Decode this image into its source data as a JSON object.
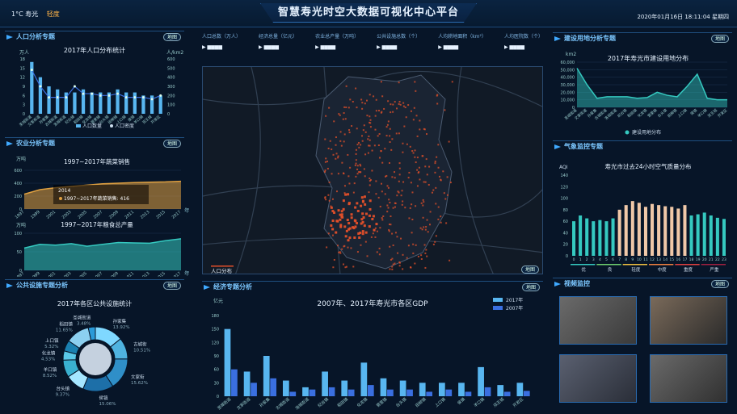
{
  "header": {
    "title": "智慧寿光时空大数据可视化中心平台",
    "weather_temp": "1°C 寿光",
    "weather_level": "轻度",
    "datetime": "2020年01月16日 18:11:04 星期四"
  },
  "stats": [
    {
      "label": "人口总数（万人）",
      "value": "—"
    },
    {
      "label": "经济总量（亿元）",
      "value": "—"
    },
    {
      "label": "农业总产量（万吨）",
      "value": "—"
    },
    {
      "label": "公共设施总数（个）",
      "value": "—"
    },
    {
      "label": "人均耕地面积（km²）",
      "value": "—"
    },
    {
      "label": "人均医院数（个）",
      "value": "—"
    }
  ],
  "map_btn": "地图",
  "panels": {
    "population": {
      "title": "人口分析专题",
      "chart_title": "2017年人口分布统计",
      "left_unit": "万人",
      "right_unit": "人/km2",
      "legend_bar": "人口数量",
      "legend_line": "人口密度"
    },
    "agriculture": {
      "title": "农业分析专题",
      "chart1_title": "1997~2017年蔬菜销售",
      "chart1_unit": "万吨",
      "tooltip_year": "2014",
      "tooltip_text": "1997~2017年蔬菜销售: 416",
      "chart2_title": "1997~2017年粮食总产量",
      "chart2_unit": "万吨",
      "year_suffix": "年"
    },
    "facilities": {
      "title": "公共设施专题分析",
      "chart_title": "2017年各区公共设施统计"
    },
    "economy": {
      "title": "经济专题分析",
      "chart_title": "2007年、2017年寿光市各区GDP",
      "unit": "亿元",
      "legend_2017": "2017年",
      "legend_2007": "2007年"
    },
    "construction": {
      "title": "建设用地分析专题",
      "chart_title": "2017年寿光市建设用地分布",
      "unit": "km2",
      "legend": "建设用地分布"
    },
    "weather": {
      "title": "气象监控专题",
      "chart_title": "寿光市过去24小时空气质量分布",
      "unit": "AQI",
      "levels": [
        "优",
        "良",
        "轻度",
        "中度",
        "重度",
        "严重"
      ]
    },
    "video": {
      "title": "视频监控"
    }
  },
  "map": {
    "legend_label": "人口分布"
  },
  "colors": {
    "accent": "#3fa9ff",
    "bar_light": "#58b6f0",
    "bar_dark": "#3a6fe0",
    "orange": "#e0a040",
    "teal": "#35c9c0",
    "peach": "#f0c8a8",
    "dot": "#e4502a"
  },
  "chart_data": [
    {
      "type": "bar",
      "name": "population",
      "categories": [
        "圣城街道",
        "文家街道",
        "孙家集",
        "古城街道",
        "洛城街道",
        "纪台镇",
        "稻田镇",
        "化龙镇",
        "营里镇",
        "台头镇",
        "田柳镇",
        "上口镇",
        "侯镇",
        "羊口镇",
        "双王城",
        "开发区"
      ],
      "series": [
        {
          "name": "人口数量",
          "type": "bar",
          "values": [
            17,
            12,
            9,
            8,
            7,
            7,
            8,
            7,
            7,
            7,
            8,
            7,
            7,
            6,
            6,
            6
          ]
        },
        {
          "name": "人口密度",
          "type": "line",
          "values": [
            480,
            300,
            180,
            180,
            180,
            300,
            220,
            220,
            200,
            200,
            220,
            180,
            180,
            180,
            160,
            200
          ]
        }
      ],
      "ylim_left": [
        0,
        18
      ],
      "ylim_right": [
        0,
        600
      ]
    },
    {
      "type": "area",
      "name": "vegetable_sales",
      "x": [
        "1997",
        "1999",
        "2001",
        "2003",
        "2005",
        "2007",
        "2009",
        "2011",
        "2013",
        "2015",
        "2017"
      ],
      "values": [
        230,
        300,
        330,
        350,
        370,
        390,
        400,
        410,
        416,
        420,
        430
      ],
      "ylim": [
        0,
        600
      ]
    },
    {
      "type": "area",
      "name": "grain_output",
      "x": [
        "1997",
        "1999",
        "2001",
        "2003",
        "2005",
        "2007",
        "2009",
        "2011",
        "2013",
        "2015",
        "2017"
      ],
      "values": [
        60,
        70,
        68,
        72,
        65,
        70,
        75,
        74,
        73,
        80,
        85
      ],
      "ylim": [
        0,
        100
      ]
    },
    {
      "type": "pie",
      "name": "facilities",
      "labels": [
        "孙家集",
        "古城街",
        "文家街",
        "侯镇",
        "台头镇",
        "羊口镇",
        "化龙镇",
        "上口镇",
        "稻田镇",
        "圣城街道"
      ],
      "values": [
        13.92,
        10.51,
        15.62,
        15.06,
        9.37,
        8.52,
        4.53,
        5.32,
        11.65,
        3.48
      ]
    },
    {
      "type": "bar",
      "name": "gdp",
      "categories": [
        "圣城街道",
        "文家街道",
        "孙家集",
        "古城街道",
        "洛城街道",
        "纪台镇",
        "稻田镇",
        "化龙镇",
        "营里镇",
        "台头镇",
        "田柳镇",
        "上口镇",
        "侯镇",
        "羊口镇",
        "双王城",
        "开发区"
      ],
      "series": [
        {
          "name": "2017年",
          "values": [
            150,
            55,
            90,
            35,
            20,
            55,
            35,
            75,
            40,
            35,
            30,
            30,
            30,
            65,
            25,
            30
          ]
        },
        {
          "name": "2007年",
          "values": [
            60,
            30,
            40,
            10,
            15,
            20,
            15,
            25,
            15,
            15,
            10,
            15,
            10,
            20,
            10,
            12
          ]
        }
      ],
      "ylim": [
        0,
        180
      ]
    },
    {
      "type": "area",
      "name": "construction",
      "categories": [
        "圣城街道",
        "文家街道",
        "孙家集",
        "古城街道",
        "洛城街道",
        "纪台镇",
        "稻田镇",
        "化龙镇",
        "营里镇",
        "台头镇",
        "田柳镇",
        "上口镇",
        "侯镇",
        "羊口镇",
        "双王城",
        "开发区"
      ],
      "values": [
        52000,
        30000,
        12000,
        14000,
        14000,
        14000,
        12000,
        13000,
        20000,
        16000,
        14000,
        28000,
        44000,
        12000,
        10000,
        10000
      ],
      "ylim": [
        0,
        60000
      ]
    },
    {
      "type": "bar",
      "name": "aqi",
      "categories": [
        "0",
        "1",
        "2",
        "3",
        "4",
        "5",
        "6",
        "7",
        "8",
        "9",
        "10",
        "11",
        "12",
        "13",
        "14",
        "15",
        "16",
        "17",
        "18",
        "19",
        "20",
        "21",
        "22",
        "23"
      ],
      "values": [
        60,
        70,
        65,
        60,
        62,
        60,
        65,
        80,
        88,
        95,
        92,
        85,
        90,
        88,
        86,
        85,
        82,
        88,
        70,
        72,
        75,
        70,
        66,
        64
      ],
      "ylim": [
        0,
        140
      ]
    }
  ]
}
